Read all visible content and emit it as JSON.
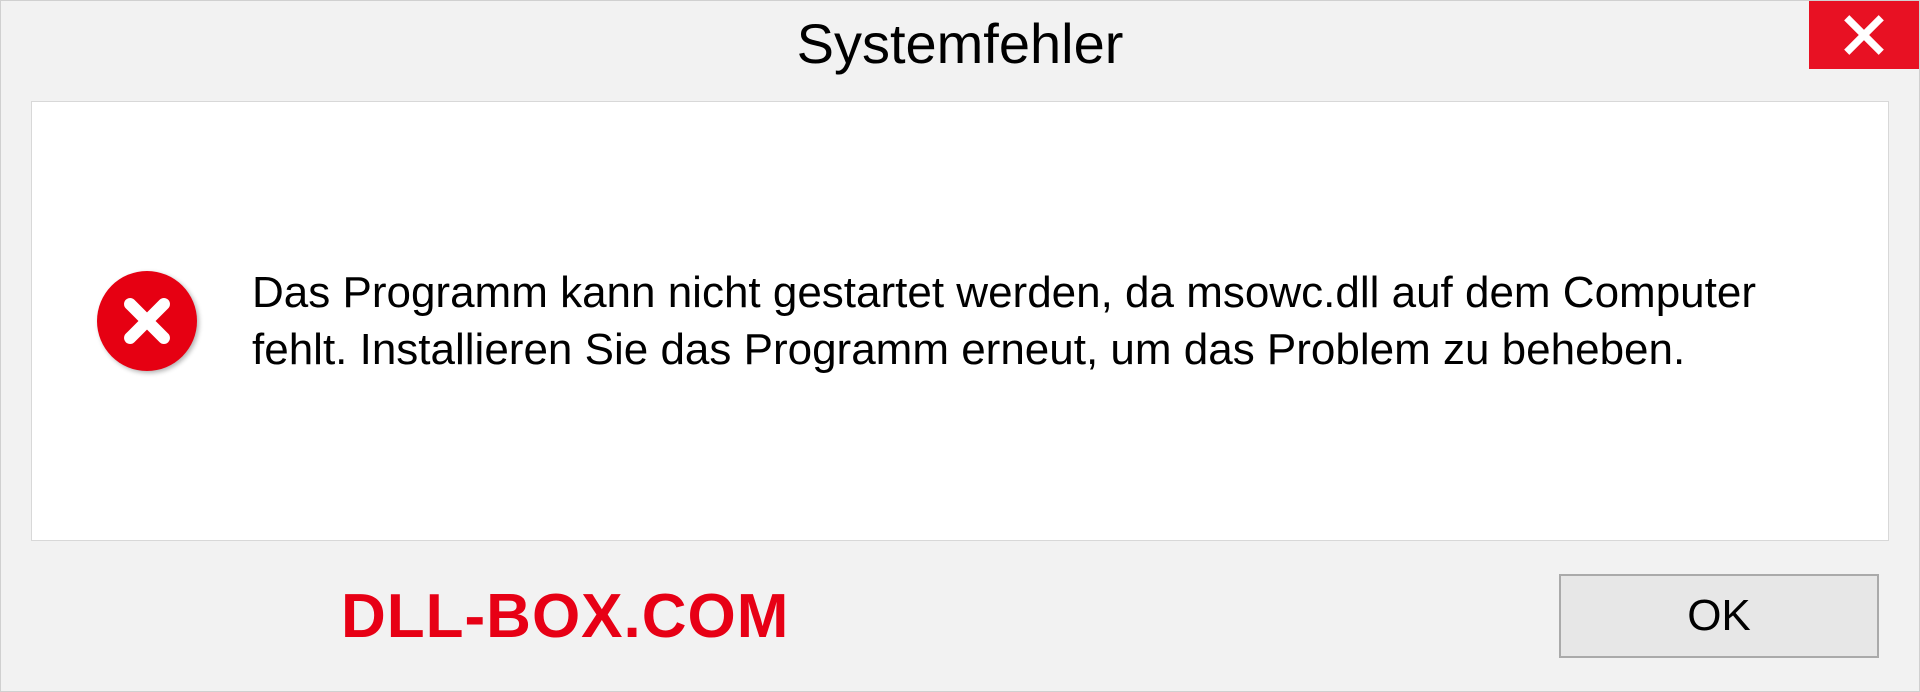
{
  "dialog": {
    "title": "Systemfehler",
    "message": "Das Programm kann nicht gestartet werden, da msowc.dll auf dem Computer fehlt. Installieren Sie das Programm erneut, um das Problem zu beheben.",
    "ok_label": "OK"
  },
  "watermark": {
    "text": "DLL-BOX.COM"
  }
}
